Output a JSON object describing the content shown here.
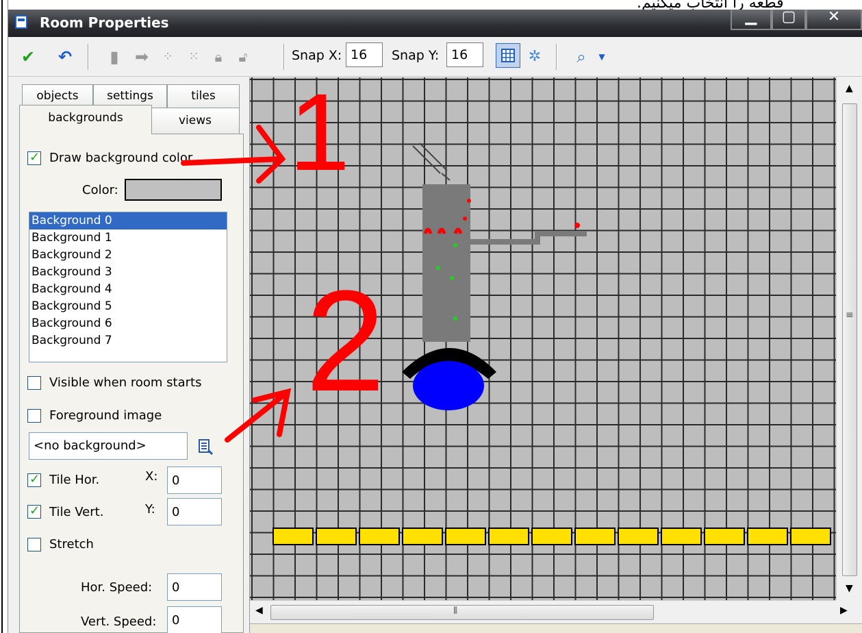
{
  "caption_text": "قطعه را انتخاب میکنیم.",
  "window": {
    "title": "Room Properties",
    "min": "▁",
    "max": "▢",
    "close": "✕"
  },
  "toolbar": {
    "ok_icon": "check-icon",
    "undo_icon": "undo-icon",
    "snap_x_label": "Snap X:",
    "snap_x_value": "16",
    "snap_y_label": "Snap Y:",
    "snap_y_value": "16",
    "grid_icon": "grid-icon",
    "zoom_icon": "zoom-icon"
  },
  "tabs": {
    "objects": "objects",
    "settings": "settings",
    "tiles": "tiles",
    "backgrounds": "backgrounds",
    "views": "views"
  },
  "panel": {
    "draw_bg_color": "Draw background color",
    "draw_bg_checked": true,
    "color_label": "Color:",
    "color_value": "#c0c0c0",
    "backgrounds": [
      "Background 0",
      "Background 1",
      "Background 2",
      "Background 3",
      "Background 4",
      "Background 5",
      "Background 6",
      "Background 7"
    ],
    "selected_background": "Background 0",
    "visible_when_starts": "Visible when room starts",
    "foreground_image": "Foreground image",
    "background_select": "<no background>",
    "tile_hor": "Tile Hor.",
    "tile_vert": "Tile Vert.",
    "x_label": "X:",
    "x_value": "0",
    "y_label": "Y:",
    "y_value": "0",
    "stretch": "Stretch",
    "hor_speed_label": "Hor. Speed:",
    "hor_speed_value": "0",
    "vert_speed_label": "Vert. Speed:",
    "vert_speed_value": "0"
  },
  "annotations": {
    "one": "1",
    "two": "2"
  },
  "colors": {
    "accent": "#316ac5",
    "annotation": "#ff0000",
    "block": "#ffe000"
  }
}
